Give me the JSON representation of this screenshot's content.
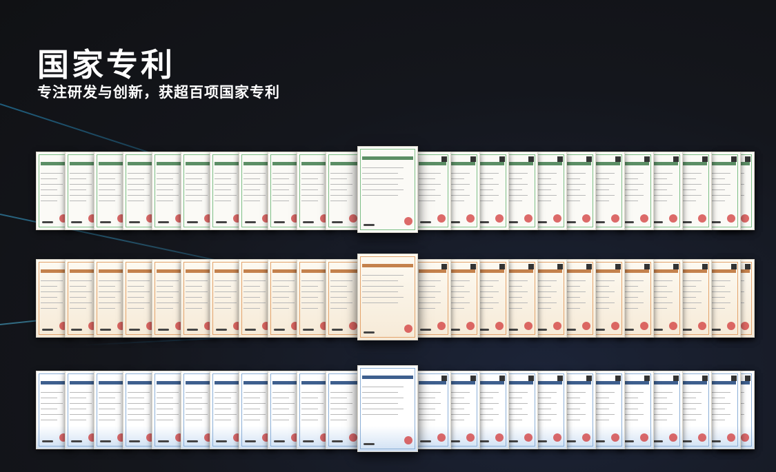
{
  "header": {
    "title": "国家专利",
    "subtitle": "专注研发与创新，获超百项国家专利"
  },
  "certificate_rows": [
    {
      "style": "green",
      "count": 25
    },
    {
      "style": "orange",
      "count": 25
    },
    {
      "style": "blue",
      "count": 25
    }
  ],
  "colors": {
    "background": "#14161c",
    "text": "#ffffff"
  }
}
